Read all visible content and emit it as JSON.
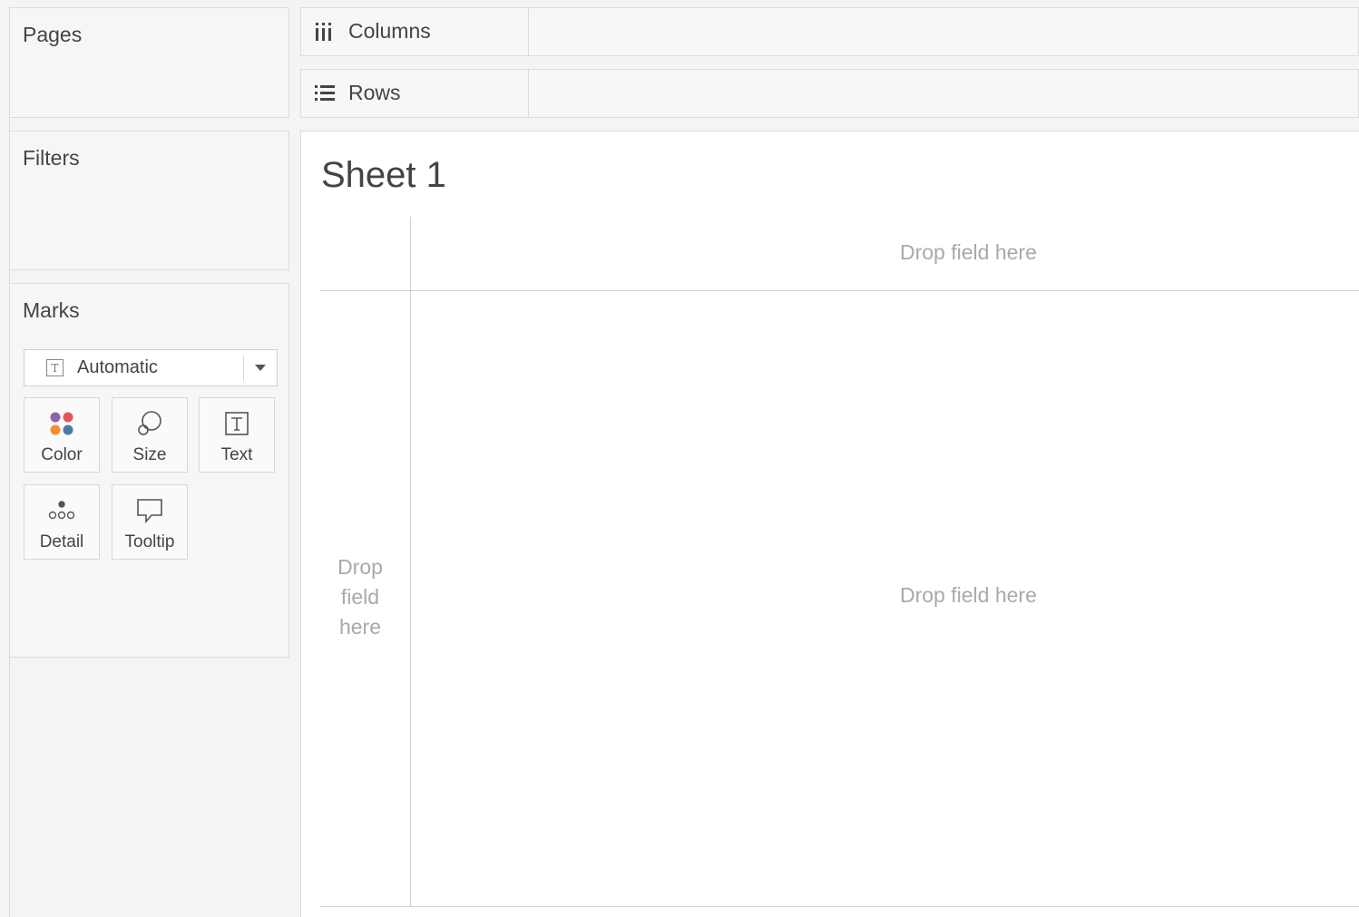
{
  "cards": {
    "pages_title": "Pages",
    "filters_title": "Filters",
    "marks_title": "Marks"
  },
  "marks": {
    "type_label": "Automatic",
    "type_icon": "text-mark-icon",
    "buttons": [
      {
        "label": "Color",
        "icon": "color-icon"
      },
      {
        "label": "Size",
        "icon": "size-icon"
      },
      {
        "label": "Text",
        "icon": "text-icon"
      },
      {
        "label": "Detail",
        "icon": "detail-icon"
      },
      {
        "label": "Tooltip",
        "icon": "tooltip-icon"
      }
    ],
    "color_dots": [
      "#8f63a6",
      "#e15759",
      "#f28e2b",
      "#4e79a7"
    ]
  },
  "shelves": {
    "columns_label": "Columns",
    "rows_label": "Rows"
  },
  "view": {
    "sheet_title": "Sheet 1",
    "drop_columns": "Drop field here",
    "drop_rows_lines": [
      "Drop",
      "field",
      "here"
    ],
    "drop_main": "Drop field here"
  }
}
